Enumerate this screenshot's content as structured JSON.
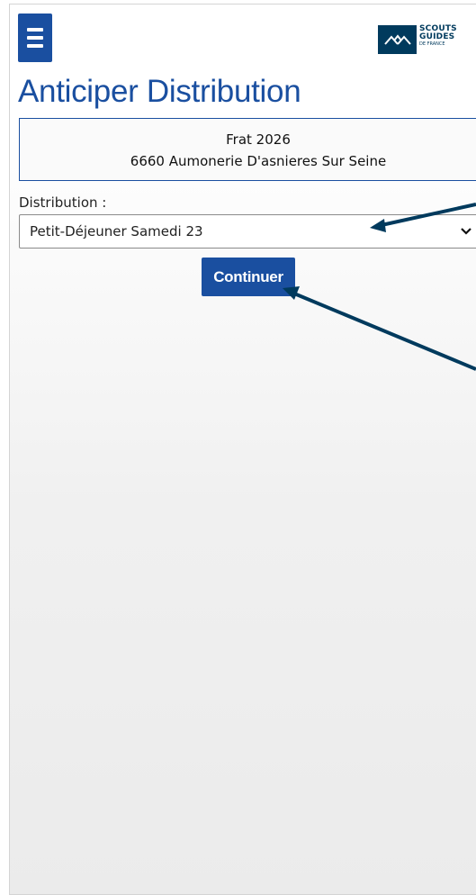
{
  "header": {
    "menu_icon": "hamburger-menu-icon",
    "logo": {
      "line1": "SCOUTS",
      "line2": "GUIDES",
      "line3": "DE FRANCE",
      "color": "#003a5d"
    }
  },
  "page": {
    "title": "Anticiper Distribution"
  },
  "info": {
    "line1": "Frat 2026",
    "line2": "6660 Aumonerie D'asnieres Sur Seine"
  },
  "form": {
    "distribution_label": "Distribution :",
    "distribution_value": "Petit-Déjeuner Samedi 23",
    "continue_label": "Continuer"
  },
  "colors": {
    "accent": "#1a4fa0",
    "annotation_arrow": "#003a5d"
  }
}
